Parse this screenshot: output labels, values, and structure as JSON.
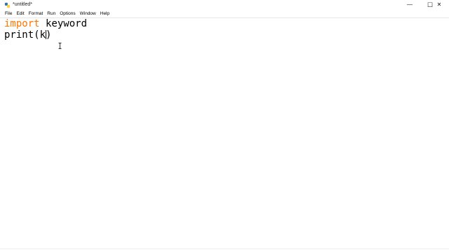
{
  "window": {
    "title": "*untitled*",
    "minimize_glyph": "—",
    "maximize_glyph": "☐",
    "close_glyph": "✕"
  },
  "menu": [
    "File",
    "Edit",
    "Format",
    "Run",
    "Options",
    "Window",
    "Help"
  ],
  "editor": {
    "line1": {
      "keyword": "import",
      "rest": " keyword"
    },
    "line2": {
      "before_caret": "print(k",
      "after_caret": ")"
    }
  },
  "colors": {
    "keyword": "#ff7700",
    "text": "#000000",
    "background": "#ffffff"
  },
  "icons": {
    "app": "idle-python-icon",
    "cursor": "text-ibeam-cursor"
  }
}
